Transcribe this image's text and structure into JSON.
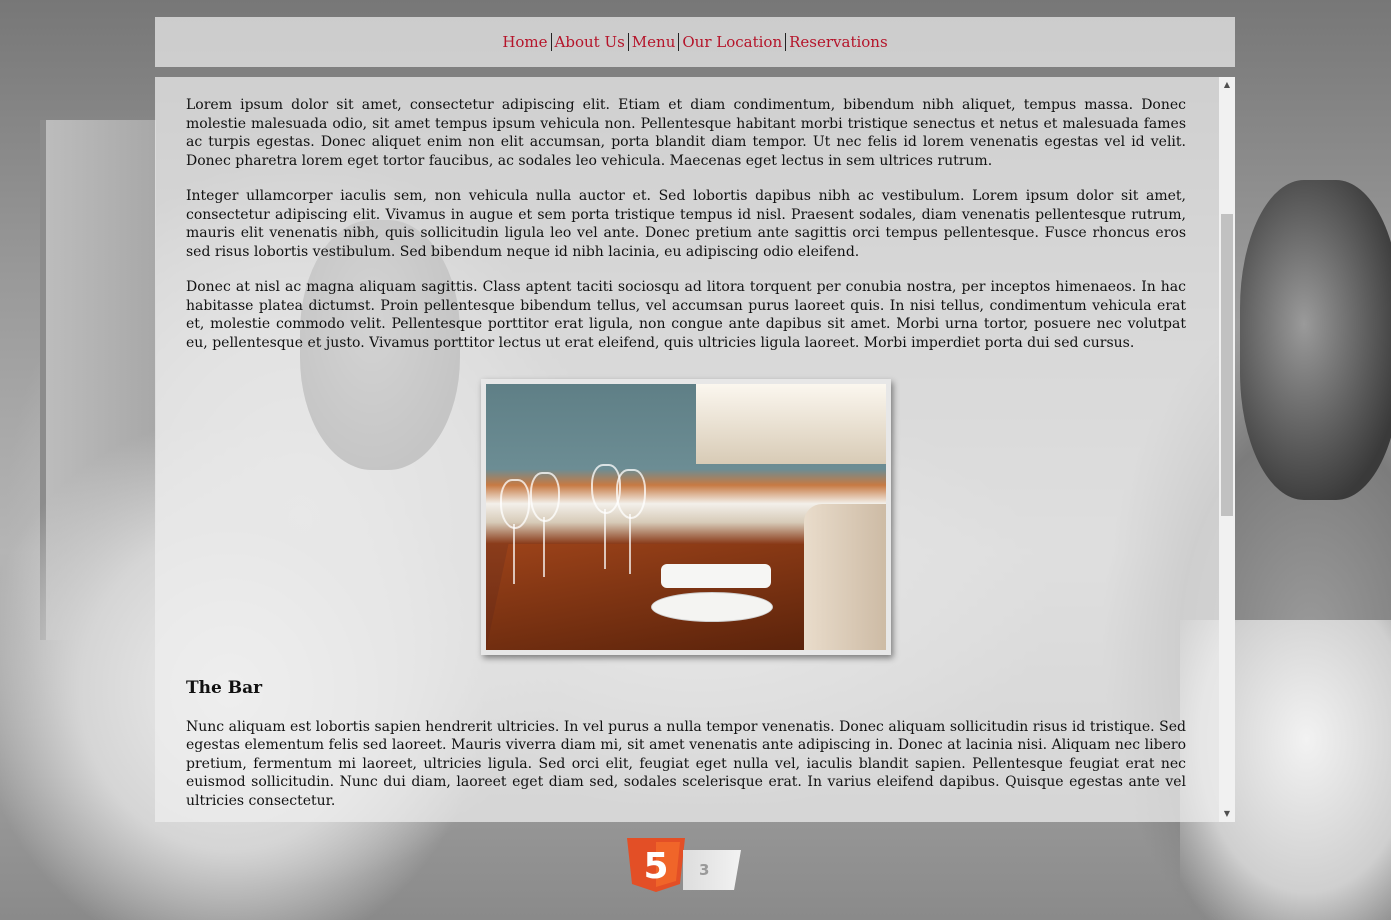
{
  "nav": {
    "items": [
      {
        "label": "Home"
      },
      {
        "label": "About Us"
      },
      {
        "label": "Menu"
      },
      {
        "label": "Our Location"
      },
      {
        "label": "Reservations"
      }
    ]
  },
  "content": {
    "paragraphs": [
      "Lorem ipsum dolor sit amet, consectetur adipiscing elit. Etiam et diam condimentum, bibendum nibh aliquet, tempus massa. Donec molestie malesuada odio, sit amet tempus ipsum vehicula non. Pellentesque habitant morbi tristique senectus et netus et malesuada fames ac turpis egestas. Donec aliquet enim non elit accumsan, porta blandit diam tempor. Ut nec felis id lorem venenatis egestas vel id velit. Donec pharetra lorem eget tortor faucibus, ac sodales leo vehicula. Maecenas eget lectus in sem ultrices rutrum.",
      "Integer ullamcorper iaculis sem, non vehicula nulla auctor et. Sed lobortis dapibus nibh ac vestibulum. Lorem ipsum dolor sit amet, consectetur adipiscing elit. Vivamus in augue et sem porta tristique tempus id nisl. Praesent sodales, diam venenatis pellentesque rutrum, mauris elit venenatis nibh, quis sollicitudin ligula leo vel ante. Donec pretium ante sagittis orci tempus pellentesque. Fusce rhoncus eros sed risus lobortis vestibulum. Sed bibendum neque id nibh lacinia, eu adipiscing odio eleifend.",
      "Donec at nisl ac magna aliquam sagittis. Class aptent taciti sociosqu ad litora torquent per conubia nostra, per inceptos himenaeos. In hac habitasse platea dictumst. Proin pellentesque bibendum tellus, vel accumsan purus laoreet quis. In nisi tellus, condimentum vehicula erat et, molestie commodo velit. Pellentesque porttitor erat ligula, non congue ante dapibus sit amet. Morbi urna tortor, posuere nec volutpat eu, pellentesque et justo. Vivamus porttitor lectus ut erat eleifend, quis ultricies ligula laoreet. Morbi imperdiet porta dui sed cursus."
    ],
    "section_heading": "The Bar",
    "section_paragraph": "Nunc aliquam est lobortis sapien hendrerit ultricies. In vel purus a nulla tempor venenatis. Donec aliquam sollicitudin risus id tristique. Sed egestas elementum felis sed laoreet. Mauris viverra diam mi, sit amet venenatis ante adipiscing in. Donec at lacinia nisi. Aliquam nec libero pretium, fermentum mi laoreet, ultricies ligula. Sed orci elit, feugiat eget nulla vel, iaculis blandit sapien. Pellentesque feugiat erat nec euismod sollicitudin. Nunc dui diam, laoreet eget diam sed, sodales scelerisque erat. In varius eleifend dapibus. Quisque egestas ante vel ultricies consectetur."
  },
  "badge": {
    "shield_text": "5",
    "tab_text": "3"
  },
  "colors": {
    "nav_link": "#b5142a",
    "html5_orange": "#e34f26"
  },
  "icons": [
    "scroll-up-arrow-icon",
    "scroll-down-arrow-icon",
    "html5-logo-icon",
    "css3-logo-icon"
  ]
}
